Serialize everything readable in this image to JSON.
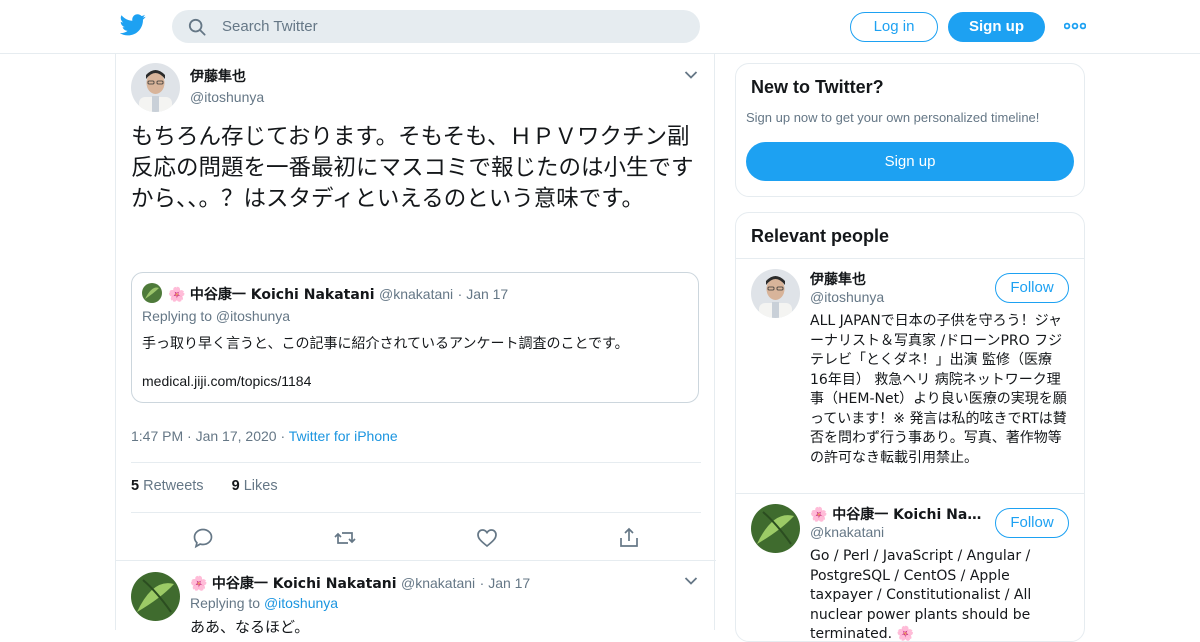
{
  "colors": {
    "accent": "#1da1f2",
    "link": "#1b95e0",
    "muted": "#657786",
    "border": "#e6ecf0"
  },
  "header": {
    "logo_icon": "twitter-bird-icon",
    "search_placeholder": "Search Twitter",
    "login_label": "Log in",
    "signup_label": "Sign up",
    "more_icon": "more-dots-icon"
  },
  "tweet": {
    "display_name": "伊藤隼也",
    "username": "@itoshunya",
    "text": "もちろん存じております。そもそも、ＨＰＶワクチン副反応の問題を一番最初にマスコミで報じたのは小生ですから、、。？はスタディといえるのという意味です。",
    "quote": {
      "name": "中谷康一 Koichi Nakatani",
      "name_emoji": "🌸",
      "username": "@knakatani",
      "date": "Jan 17",
      "replying_to": "Replying to @itoshunya",
      "text": "手っ取り早く言うと、この記事に紹介されているアンケート調査のことです。",
      "link": "medical.jiji.com/topics/1184"
    },
    "time": "1:47 PM",
    "date": "Jan 17, 2020",
    "source": "Twitter for iPhone",
    "retweets_count": "5",
    "retweets_label": "Retweets",
    "likes_count": "9",
    "likes_label": "Likes"
  },
  "reply": {
    "name_emoji": "🌸",
    "name": "中谷康一 Koichi Nakatani",
    "username": "@knakatani",
    "date": "Jan 17",
    "replying_prefix": "Replying to",
    "replying_handle": "@itoshunya",
    "text": "ああ、なるほど。"
  },
  "sidebar": {
    "new_title": "New to Twitter?",
    "new_subtitle": "Sign up now to get your own personalized timeline!",
    "new_signup": "Sign up",
    "people_title": "Relevant people",
    "people": [
      {
        "name": "伊藤隼也",
        "handle": "@itoshunya",
        "follow": "Follow",
        "bio": "ALL JAPANで日本の子供を守ろう！ジャーナリスト＆写真家 /ドローンPRO フジテレビ「とくダネ！」出演 監修（医療 16年目） 救急ヘリ 病院ネットワーク理事（HEM-Net）より良い医療の実現を願っています！※ 発言は私的呟きでRTは賛否を問わず行う事あり。写真、著作物等の許可なき転載引用禁止。"
      },
      {
        "name": "🌸 中谷康一 Koichi Nak...",
        "handle": "@knakatani",
        "follow": "Follow",
        "bio": "Go / Perl / JavaScript / Angular / PostgreSQL / CentOS / Apple taxpayer / Constitutionalist / All nuclear power plants should be terminated. 🌸"
      }
    ]
  }
}
